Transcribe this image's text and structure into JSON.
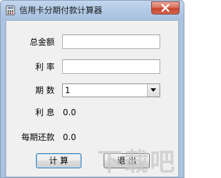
{
  "window": {
    "title": "信用卡分期付款计算器",
    "icon": "calculator-icon",
    "close_icon": "close-icon"
  },
  "form": {
    "total_label": "总金额",
    "total_value": "",
    "rate_label": "利 率",
    "rate_value": "",
    "periods_label": "期 数",
    "periods_selected": "1",
    "interest_label": "利 息",
    "interest_value": "0.0",
    "monthly_label": "每期还款",
    "monthly_value": "0.0"
  },
  "buttons": {
    "calculate_label": "计 算",
    "exit_label": "退 出"
  },
  "watermark": {
    "text": "下载吧"
  },
  "colors": {
    "titlebar": "#b4cbe6",
    "client_bg": "#f0f0f0",
    "close_red": "#c7432d"
  }
}
